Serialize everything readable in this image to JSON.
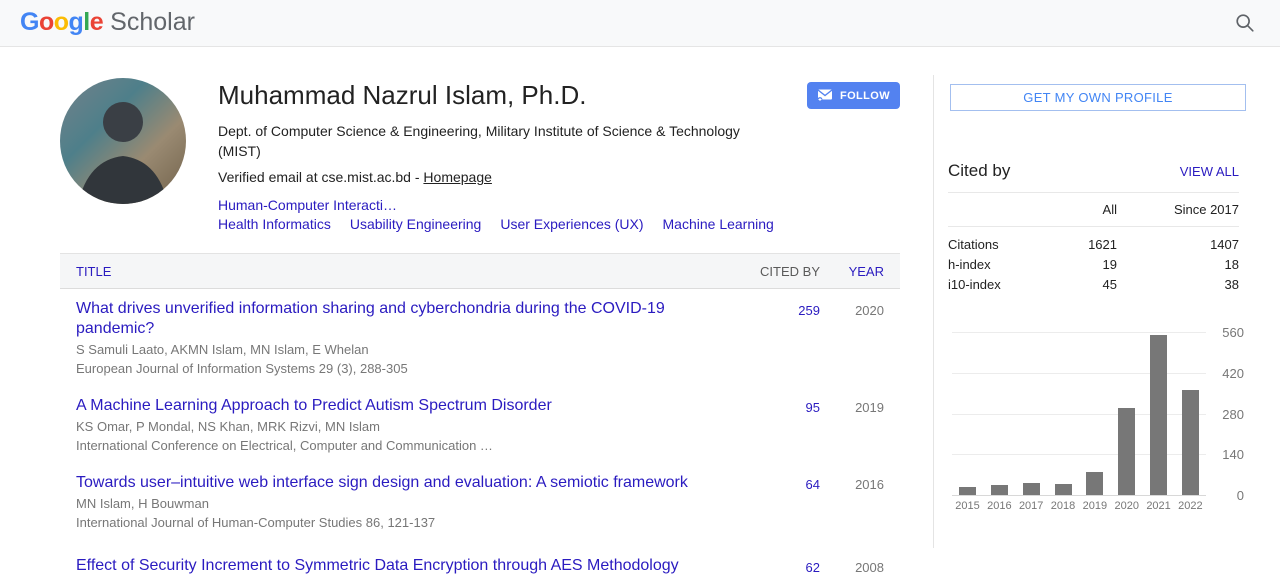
{
  "header": {
    "logo": {
      "letters": [
        {
          "ch": "G",
          "color": "#4285F4"
        },
        {
          "ch": "o",
          "color": "#EA4335"
        },
        {
          "ch": "o",
          "color": "#FBBC05"
        },
        {
          "ch": "g",
          "color": "#4285F4"
        },
        {
          "ch": "l",
          "color": "#34A853"
        },
        {
          "ch": "e",
          "color": "#EA4335"
        }
      ],
      "scholar": "Scholar"
    },
    "search_icon": "magnifying-glass"
  },
  "profile": {
    "name": "Muhammad Nazrul Islam, Ph.D.",
    "affiliation": "Dept. of Computer Science & Engineering, Military Institute of Science & Technology (MIST)",
    "verified_email_prefix": "Verified email at cse.mist.ac.bd - ",
    "homepage_label": "Homepage",
    "follow_button": "FOLLOW",
    "interests": [
      "Human-Computer Interacti…",
      "Health Informatics",
      "Usability Engineering",
      "User Experiences (UX)",
      "Machine Learning"
    ]
  },
  "publications": {
    "header": {
      "title": "TITLE",
      "cited_by": "CITED BY",
      "year": "YEAR"
    },
    "items": [
      {
        "title": "What drives unverified information sharing and cyberchondria during the COVID-19 pandemic?",
        "authors": "S Samuli Laato, AKMN Islam, MN Islam, E Whelan",
        "venue": "European Journal of Information Systems 29 (3), 288-305",
        "cited_by": "259",
        "year": "2020"
      },
      {
        "title": "A Machine Learning Approach to Predict Autism Spectrum Disorder",
        "authors": "KS Omar, P Mondal, NS Khan, MRK Rizvi, MN Islam",
        "venue": "International Conference on Electrical, Computer and Communication …",
        "cited_by": "95",
        "year": "2019"
      },
      {
        "title": "Towards user–intuitive web interface sign design and evaluation: A semiotic framework",
        "authors": "MN Islam, H Bouwman",
        "venue": "International Journal of Human-Computer Studies 86, 121-137",
        "cited_by": "64",
        "year": "2016"
      },
      {
        "title": "Effect of Security Increment to Symmetric Data Encryption through AES Methodology",
        "cited_by": "62",
        "year": "2008"
      }
    ]
  },
  "sidebar": {
    "get_profile_button": "GET MY OWN PROFILE",
    "cited_by_panel": {
      "title": "Cited by",
      "view_all": "VIEW ALL",
      "col_all": "All",
      "col_since": "Since 2017",
      "rows": [
        {
          "label": "Citations",
          "all": "1621",
          "since": "1407"
        },
        {
          "label": "h-index",
          "all": "19",
          "since": "18"
        },
        {
          "label": "i10-index",
          "all": "45",
          "since": "38"
        }
      ]
    }
  },
  "chart_data": {
    "type": "bar",
    "title": "",
    "xlabel": "",
    "ylabel": "",
    "categories": [
      "2015",
      "2016",
      "2017",
      "2018",
      "2019",
      "2020",
      "2021",
      "2022"
    ],
    "values": [
      28,
      34,
      40,
      38,
      80,
      300,
      550,
      360
    ],
    "ylim": [
      0,
      560
    ],
    "yticks": [
      0,
      140,
      280,
      420,
      560
    ],
    "grid": true,
    "legend": "none",
    "bar_color": "#777777",
    "tick_label_color": "#777777"
  },
  "colors": {
    "link": "#2a1bc0",
    "accent_blue": "#4285f4",
    "follow_blue": "#5382f0",
    "text_gray": "#777777",
    "header_bg": "#f8f9fa"
  }
}
